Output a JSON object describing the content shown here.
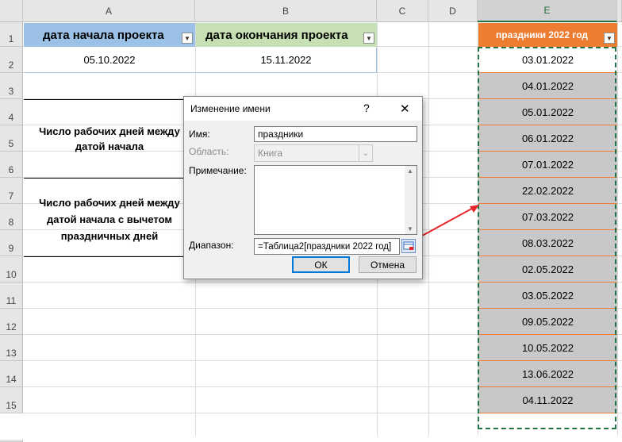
{
  "columns": {
    "A": "A",
    "B": "B",
    "C": "C",
    "D": "D",
    "E": "E"
  },
  "rows": [
    "1",
    "2",
    "3",
    "4",
    "5",
    "6",
    "7",
    "8",
    "9",
    "10",
    "11",
    "12",
    "13",
    "14",
    "15"
  ],
  "table1": {
    "header_start": "дата начала проекта",
    "header_end": "дата окончания проекта",
    "start_date": "05.10.2022",
    "end_date": "15.11.2022"
  },
  "labels": {
    "workdays": "Число рабочих дней между датой начала",
    "workdays_holidays": "Число рабочих дней между датой начала с вычетом праздничных дней"
  },
  "table2": {
    "header": "праздники 2022 год",
    "dates": [
      "03.01.2022",
      "04.01.2022",
      "05.01.2022",
      "06.01.2022",
      "07.01.2022",
      "22.02.2022",
      "07.03.2022",
      "08.03.2022",
      "02.05.2022",
      "03.05.2022",
      "09.05.2022",
      "10.05.2022",
      "13.06.2022",
      "04.11.2022"
    ]
  },
  "dialog": {
    "title": "Изменение имени",
    "help": "?",
    "close": "✕",
    "name_label": "Имя:",
    "name_value": "праздники",
    "scope_label": "Область:",
    "scope_value": "Книга",
    "comment_label": "Примечание:",
    "comment_value": "",
    "range_label": "Диапазон:",
    "range_value": "=Таблица2[праздники 2022 год]",
    "ok": "ОК",
    "cancel": "Отмена"
  },
  "colors": {
    "accent_green": "#217346",
    "header_blue": "#9bc2e6",
    "header_green": "#c6e0b4",
    "header_orange": "#ed7d31",
    "arrow": "#e8262a"
  }
}
